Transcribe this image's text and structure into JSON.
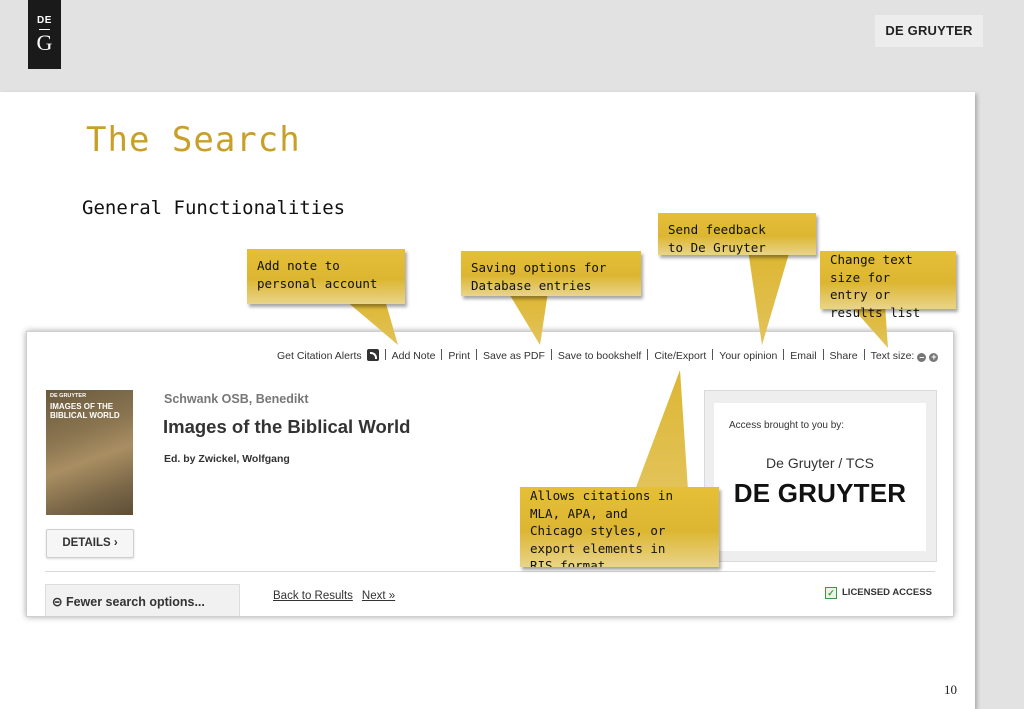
{
  "brand": {
    "logo_top": "DE",
    "logo_bottom": "G",
    "name": "DE GRUYTER"
  },
  "slide": {
    "title": "The Search",
    "subtitle": "General Functionalities",
    "page_number": "10"
  },
  "toolbar": {
    "citation_alerts": "Get Citation Alerts",
    "add_note": "Add Note",
    "print": "Print",
    "save_pdf": "Save as PDF",
    "save_bookshelf": "Save to bookshelf",
    "cite_export": "Cite/Export",
    "your_opinion": "Your opinion",
    "email": "Email",
    "share": "Share",
    "text_size": "Text size:"
  },
  "book": {
    "cover_publisher": "DE GRUYTER",
    "cover_title": "IMAGES OF THE BIBLICAL WORLD",
    "author": "Schwank OSB, Benedikt",
    "title": "Images of the Biblical World",
    "editor": "Ed. by Zwickel, Wolfgang",
    "details_label": "DETAILS  ›"
  },
  "access": {
    "label": "Access brought to you by:",
    "institution": "De Gruyter / TCS",
    "brand": "DE GRUYTER"
  },
  "footer_bar": {
    "fewer_options": "Fewer search options...",
    "back_to_results": "Back to Results",
    "next": "Next »",
    "licensed": "LICENSED ACCESS"
  },
  "callouts": {
    "add_note": "Add note to\npersonal account",
    "saving": "Saving options for\nDatabase entries",
    "feedback": "Send feedback\nto De Gruyter",
    "text_size": "Change text\nsize for\nentry or\nresults list",
    "citations": "Allows citations in\nMLA, APA, and\nChicago styles, or\nexport elements in\nRIS format"
  },
  "colors": {
    "title_gold": "#c8a028",
    "callout_gold": "#dcb632"
  }
}
